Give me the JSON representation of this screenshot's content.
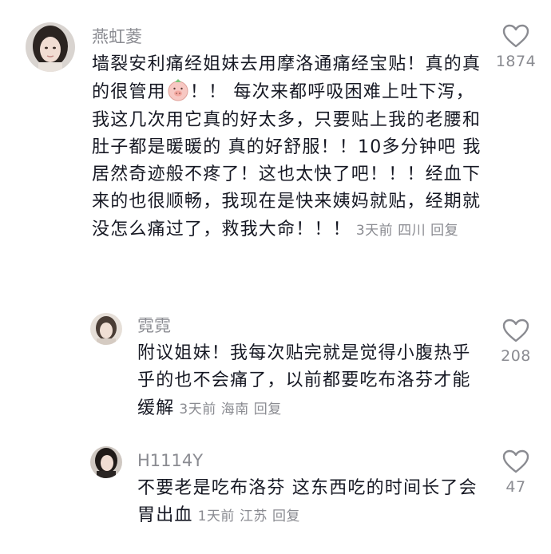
{
  "comments": [
    {
      "username": "燕虹菱",
      "text_before_emoji": "墙裂安利痛经姐妹去用摩洛通痛经宝贴！真的真的很管用",
      "text_after_emoji": "！！ 每次来都呼吸困难上吐下泻，我这几次用它真的好太多，只要贴上我的老腰和肚子都是暖暖的 真的好舒服！！10多分钟吧 我居然奇迹般不疼了！这也太快了吧！！！经血下来的也很顺畅，我现在是快来姨妈就贴，经期就没怎么痛过了，救我大命！！！",
      "time": "3天前",
      "location": "四川",
      "reply": "回复",
      "likes": "1874"
    },
    {
      "username": "霓霓",
      "text": "附议姐妹！我每次贴完就是觉得小腹热乎乎的也不会痛了，以前都要吃布洛芬才能缓解",
      "time": "3天前",
      "location": "海南",
      "reply": "回复",
      "likes": "208"
    },
    {
      "username": "H1114Y",
      "text": "不要老是吃布洛芬 这东西吃的时间长了会胃出血",
      "time": "1天前",
      "location": "江苏",
      "reply": "回复",
      "likes": "47"
    }
  ],
  "icons": {
    "like": "heart-outline-icon",
    "emoji": "pig-face-emoji-icon"
  },
  "colors": {
    "text": "#161823",
    "meta": "#8a8b91",
    "heart_stroke": "#8a8b91"
  }
}
